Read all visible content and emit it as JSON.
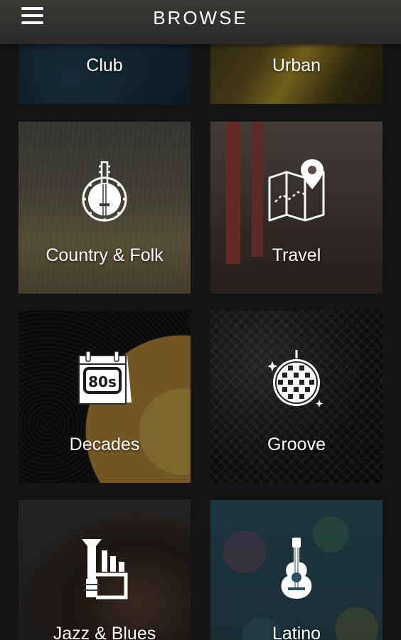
{
  "header": {
    "title": "BROWSE",
    "menu_icon": "hamburger-menu-icon"
  },
  "tiles": [
    {
      "label": "Club",
      "icon": "none"
    },
    {
      "label": "Urban",
      "icon": "none"
    },
    {
      "label": "Country & Folk",
      "icon": "banjo-icon"
    },
    {
      "label": "Travel",
      "icon": "map-pin-icon"
    },
    {
      "label": "Decades",
      "icon": "calendar-80s-icon"
    },
    {
      "label": "Groove",
      "icon": "disco-ball-icon"
    },
    {
      "label": "Jazz & Blues",
      "icon": "trumpet-icon"
    },
    {
      "label": "Latino",
      "icon": "guitar-icon"
    }
  ],
  "decades_badge": "80s"
}
